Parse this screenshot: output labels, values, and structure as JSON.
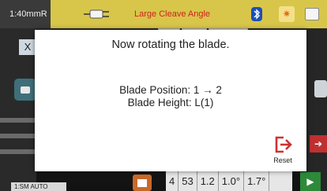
{
  "status_bar": {
    "left_text": "1:40mmR",
    "title": "Large Cleave Angle",
    "icons": [
      "plug-icon",
      "bluetooth-icon",
      "brightness-icon",
      "battery-icon"
    ],
    "title_color": "#d02020",
    "bar_color": "#d8c64a"
  },
  "background": {
    "close_label": "X",
    "bottom_left_label": "1:SM AUTO",
    "values": [
      "4",
      "53",
      "1.2",
      "1.0°",
      "1.7°"
    ]
  },
  "modal": {
    "title": "Now rotating the blade.",
    "blade_position": "Blade Position: 1 → 2",
    "blade_height": "Blade Height: L(1)",
    "reset_label": "Reset",
    "reset_color": "#d03030"
  }
}
